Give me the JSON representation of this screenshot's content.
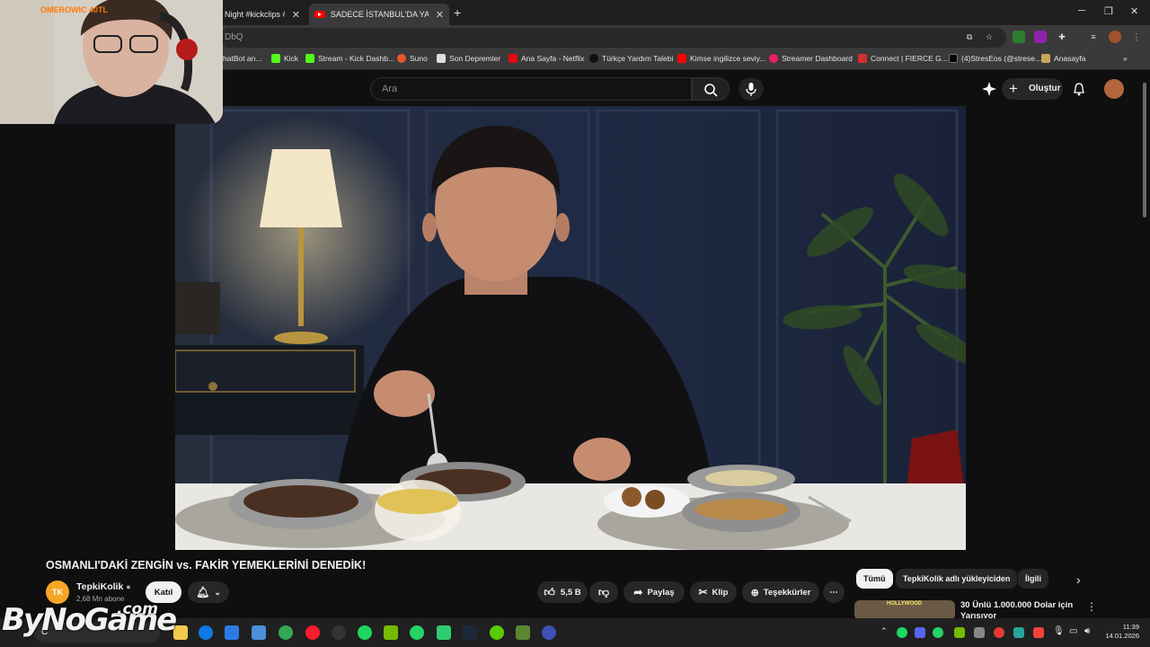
{
  "browser": {
    "tabs": [
      {
        "label": "Night #kickclips #d"
      },
      {
        "label": "SADECE İSTANBUL'DA YAŞAYAN"
      }
    ],
    "address": "DbQ",
    "bookmarks": [
      "hatBot an...",
      "Kick",
      "Stream - Kick Dashb...",
      "Suno",
      "Son Depremler",
      "Ana Sayfa - Netflix",
      "Türkçe Yardım Talebi",
      "Kimse ingilizce seviy...",
      "Streamer Dashboard",
      "Connect | FIERCE G...",
      "(4)StresEos (@strese...",
      "Anasayfa"
    ]
  },
  "webcam": {
    "overlay": "OMEROWIC 40TL"
  },
  "youtube": {
    "search_placeholder": "Ara",
    "create_label": "Oluştur",
    "video_title": "OSMANLI'DAKİ ZENGİN vs. FAKİR YEMEKLERİNİ DENEDİK!",
    "channel": {
      "logo": "TK",
      "name": "TepkiKolik",
      "subs": "2,68 Mn abone"
    },
    "join_label": "Katıl",
    "like_count": "5,5 B",
    "share_label": "Paylaş",
    "clip_label": "Klip",
    "thanks_label": "Teşekkürler",
    "chips": [
      "Tümü",
      "TepkiKolik adlı yükleyiciden",
      "İlgili"
    ],
    "recommended": {
      "title": "30 Ünlü 1.000.000 Dolar için Yarışıyor",
      "thumb_text": "HOLLYWOOD"
    }
  },
  "taskbar": {
    "time": "11:39",
    "date": "14.01.2026",
    "search": "C"
  },
  "watermark": {
    "main": "ByNoGame",
    "tld": ".com"
  },
  "colors": {
    "yt_red": "#ff0000",
    "bg": "#0f0f0f",
    "overlay": "#ff7a00"
  }
}
